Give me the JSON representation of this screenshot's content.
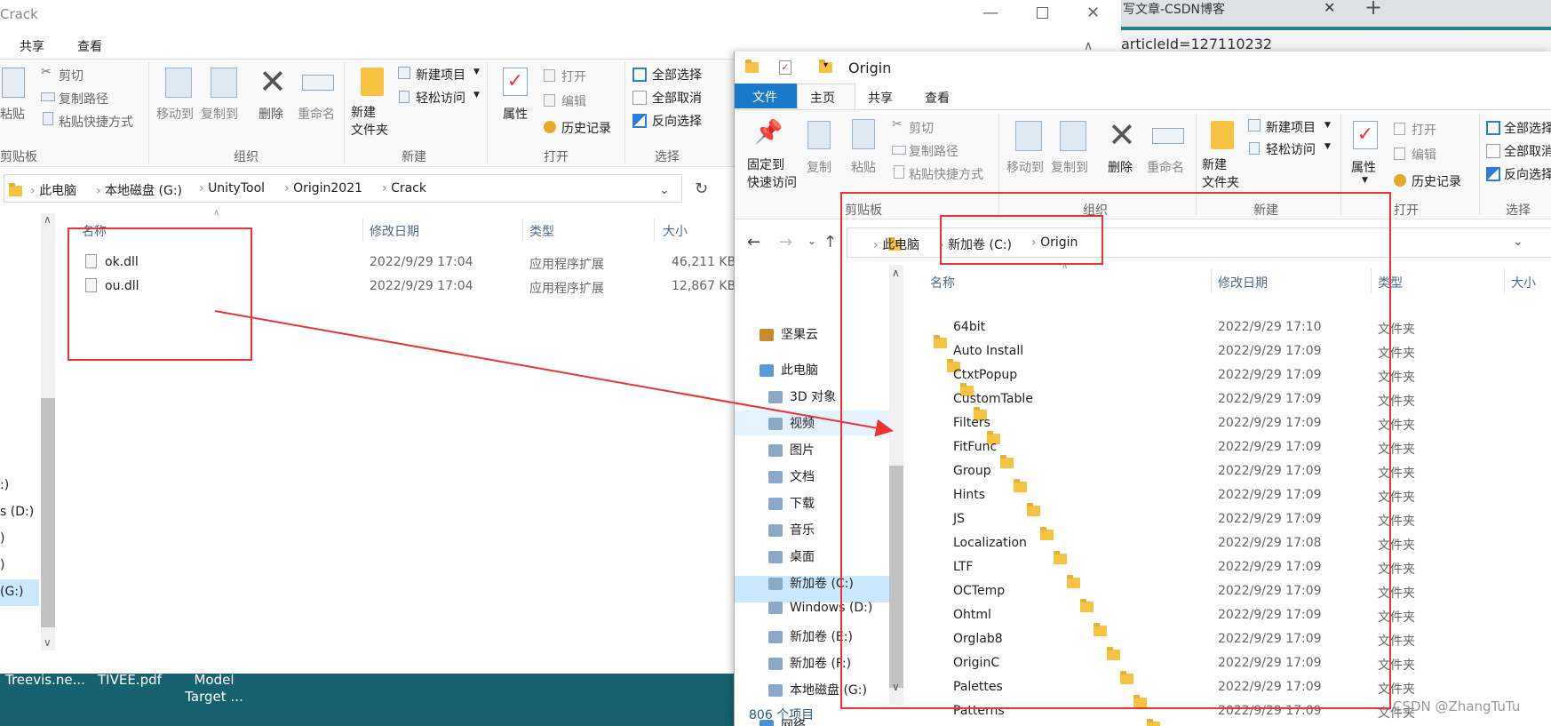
{
  "desktop": {
    "icons": [
      "Treevis.ne...",
      "TIVEE.pdf",
      "Model\nTarget ..."
    ],
    "watermark": "CSDN @ZhangTuTu"
  },
  "browser": {
    "tab_title": "写文章-CSDN博客",
    "url_fragment": "articleId=127110232"
  },
  "left_window": {
    "title": "Crack",
    "window_controls": [
      "minimize",
      "maximize",
      "close"
    ],
    "ribbon_tabs": [
      "共享",
      "查看"
    ],
    "ribbon": {
      "clipboard": {
        "paste": "粘贴",
        "cut": "剪切",
        "copy_path": "复制路径",
        "paste_shortcut": "粘贴快捷方式",
        "group": "剪贴板"
      },
      "organize": {
        "move_to": "移动到",
        "copy_to": "复制到",
        "delete": "删除",
        "rename": "重命名",
        "group": "组织"
      },
      "new": {
        "new_folder": "新建\n文件夹",
        "new_item": "新建项目",
        "easy_access": "轻松访问",
        "group": "新建"
      },
      "open": {
        "properties": "属性",
        "open": "打开",
        "edit": "编辑",
        "history": "历史记录",
        "group": "打开"
      },
      "select": {
        "select_all": "全部选择",
        "select_none": "全部取消",
        "invert": "反向选择",
        "group": "选择"
      }
    },
    "breadcrumb": [
      "此电脑",
      "本地磁盘 (G:)",
      "UnityTool",
      "Origin2021",
      "Crack"
    ],
    "columns": [
      "名称",
      "修改日期",
      "类型",
      "大小"
    ],
    "files": [
      {
        "name": "ok.dll",
        "date": "2022/9/29 17:04",
        "type": "应用程序扩展",
        "size": "46,211 KB"
      },
      {
        "name": "ou.dll",
        "date": "2022/9/29 17:04",
        "type": "应用程序扩展",
        "size": "12,867 KB"
      }
    ],
    "nav_fragments": [
      ":)",
      "s (D:)",
      ")",
      ")",
      "(G:)"
    ]
  },
  "right_window": {
    "title": "Origin",
    "ribbon_tabs": [
      "文件",
      "主页",
      "共享",
      "查看"
    ],
    "active_tab": "主页",
    "ribbon": {
      "pin": "固定到\n快速访问",
      "copy": "复制",
      "paste": "粘贴",
      "cut": "剪切",
      "copy_path": "复制路径",
      "paste_shortcut": "粘贴快捷方式",
      "g_clipboard": "剪贴板",
      "move_to": "移动到",
      "copy_to": "复制到",
      "delete": "删除",
      "rename": "重命名",
      "g_organize": "组织",
      "new_folder": "新建\n文件夹",
      "new_item": "新建项目",
      "easy_access": "轻松访问",
      "g_new": "新建",
      "properties": "属性",
      "open": "打开",
      "edit": "编辑",
      "history": "历史记录",
      "g_open": "打开",
      "select_all": "全部选择",
      "select_none": "全部取消",
      "invert": "反向选择",
      "g_select": "选择"
    },
    "breadcrumb": [
      "此电脑",
      "新加卷 (C:)",
      "Origin"
    ],
    "columns": [
      "名称",
      "修改日期",
      "类型",
      "大小"
    ],
    "nav": [
      {
        "label": "坚果云",
        "icon": "nutstore-icon"
      },
      {
        "label": "此电脑",
        "icon": "computer-icon"
      },
      {
        "label": "3D 对象",
        "icon": "3d-objects-icon"
      },
      {
        "label": "视频",
        "icon": "video-icon"
      },
      {
        "label": "图片",
        "icon": "pictures-icon"
      },
      {
        "label": "文档",
        "icon": "documents-icon"
      },
      {
        "label": "下载",
        "icon": "download-icon"
      },
      {
        "label": "音乐",
        "icon": "music-icon"
      },
      {
        "label": "桌面",
        "icon": "desktop-icon"
      },
      {
        "label": "新加卷 (C:)",
        "icon": "windows-drive-icon"
      },
      {
        "label": "Windows (D:)",
        "icon": "drive-icon"
      },
      {
        "label": "新加卷 (E:)",
        "icon": "drive-icon"
      },
      {
        "label": "新加卷 (F:)",
        "icon": "drive-icon"
      },
      {
        "label": "本地磁盘 (G:)",
        "icon": "drive-icon"
      },
      {
        "label": "网络",
        "icon": "network-icon"
      }
    ],
    "folders": [
      {
        "name": "64bit",
        "date": "2022/9/29 17:10",
        "type": "文件夹"
      },
      {
        "name": "Auto Install",
        "date": "2022/9/29 17:09",
        "type": "文件夹"
      },
      {
        "name": "CtxtPopup",
        "date": "2022/9/29 17:09",
        "type": "文件夹"
      },
      {
        "name": "CustomTable",
        "date": "2022/9/29 17:09",
        "type": "文件夹"
      },
      {
        "name": "Filters",
        "date": "2022/9/29 17:09",
        "type": "文件夹"
      },
      {
        "name": "FitFunc",
        "date": "2022/9/29 17:09",
        "type": "文件夹"
      },
      {
        "name": "Group",
        "date": "2022/9/29 17:09",
        "type": "文件夹"
      },
      {
        "name": "Hints",
        "date": "2022/9/29 17:09",
        "type": "文件夹"
      },
      {
        "name": "JS",
        "date": "2022/9/29 17:09",
        "type": "文件夹"
      },
      {
        "name": "Localization",
        "date": "2022/9/29 17:08",
        "type": "文件夹"
      },
      {
        "name": "LTF",
        "date": "2022/9/29 17:09",
        "type": "文件夹"
      },
      {
        "name": "OCTemp",
        "date": "2022/9/29 17:09",
        "type": "文件夹"
      },
      {
        "name": "Ohtml",
        "date": "2022/9/29 17:09",
        "type": "文件夹"
      },
      {
        "name": "Orglab8",
        "date": "2022/9/29 17:09",
        "type": "文件夹"
      },
      {
        "name": "OriginC",
        "date": "2022/9/29 17:09",
        "type": "文件夹"
      },
      {
        "name": "Palettes",
        "date": "2022/9/29 17:09",
        "type": "文件夹"
      },
      {
        "name": "Patterns",
        "date": "2022/9/29 17:09",
        "type": "文件夹"
      }
    ],
    "status": "806 个项目"
  },
  "colors": {
    "accent": "#1979ca",
    "annotation": "#ee3333",
    "selected": "#cce8ff",
    "hover": "#e5f3ff"
  }
}
